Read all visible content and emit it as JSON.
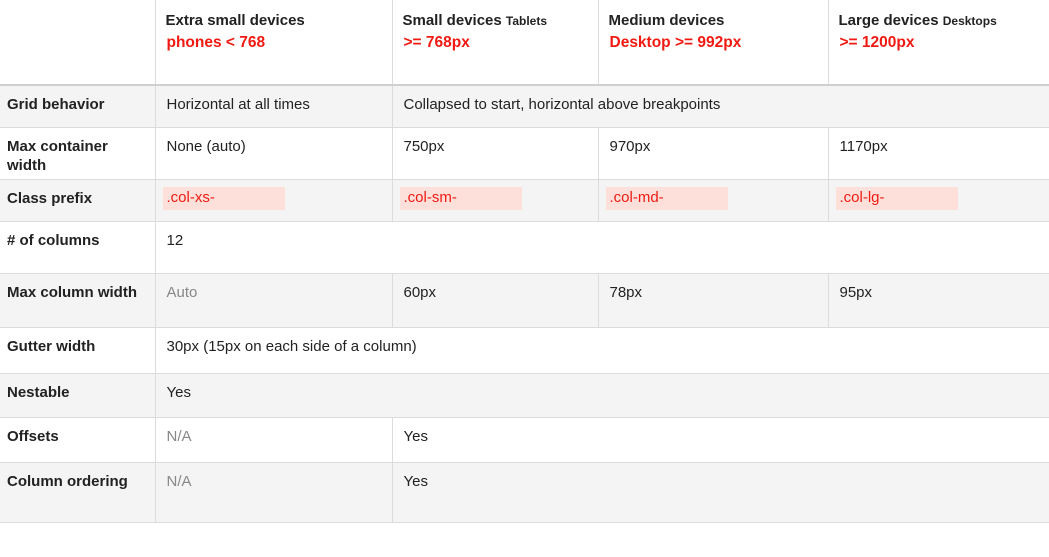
{
  "header": {
    "corner": "",
    "cols": [
      {
        "title": "Extra small devices",
        "small": "",
        "sub": "phones < 768"
      },
      {
        "title": "Small devices",
        "small": "Tablets",
        "sub": ">= 768px"
      },
      {
        "title": "Medium devices",
        "small": "",
        "sub": "Desktop >= 992px"
      },
      {
        "title": "Large devices",
        "small": "Desktops",
        "sub": ">= 1200px"
      }
    ]
  },
  "rows": {
    "grid_behavior": {
      "label": "Grid behavior",
      "xs": "Horizontal at all times",
      "rest": "Collapsed to start, horizontal above breakpoints"
    },
    "max_container": {
      "label": "Max container width",
      "xs": "None (auto)",
      "sm": "750px",
      "md": "970px",
      "lg": "1170px"
    },
    "class_prefix": {
      "label": "Class prefix",
      "xs": ".col-xs-",
      "sm": ".col-sm-",
      "md": ".col-md-",
      "lg": ".col-lg-"
    },
    "num_columns": {
      "label": "# of columns",
      "value": "12"
    },
    "max_column": {
      "label": "Max column width",
      "xs": "Auto",
      "sm": "60px",
      "md": "78px",
      "lg": "95px"
    },
    "gutter": {
      "label": "Gutter width",
      "value": "30px (15px on each side of a column)"
    },
    "nestable": {
      "label": "Nestable",
      "value": "Yes"
    },
    "offsets": {
      "label": "Offsets",
      "xs": "N/A",
      "rest": "Yes"
    },
    "ordering": {
      "label": "Column ordering",
      "xs": "N/A",
      "rest": "Yes"
    }
  }
}
